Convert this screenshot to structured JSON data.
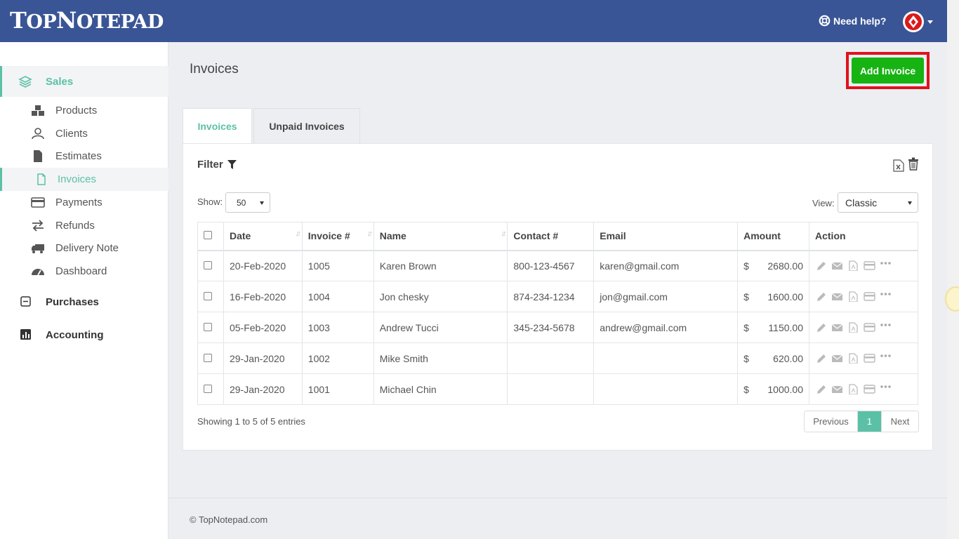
{
  "app": {
    "logo_text": "TopNotepad",
    "help_label": "Need help?"
  },
  "sidebar": {
    "sections": [
      {
        "label": "Sales",
        "icon": "layers-icon"
      },
      {
        "label": "Purchases",
        "icon": "minus-square-icon"
      },
      {
        "label": "Accounting",
        "icon": "bar-chart-icon"
      }
    ],
    "items": [
      {
        "label": "Products",
        "icon": "cubes-icon"
      },
      {
        "label": "Clients",
        "icon": "user-icon"
      },
      {
        "label": "Estimates",
        "icon": "file-icon"
      },
      {
        "label": "Invoices",
        "icon": "file-outline-icon",
        "active": true
      },
      {
        "label": "Payments",
        "icon": "credit-card-icon"
      },
      {
        "label": "Refunds",
        "icon": "exchange-icon"
      },
      {
        "label": "Delivery Note",
        "icon": "truck-icon"
      },
      {
        "label": "Dashboard",
        "icon": "dashboard-icon"
      }
    ]
  },
  "main": {
    "title": "Invoices",
    "add_button": "Add Invoice",
    "tabs": [
      {
        "label": "Invoices",
        "active": true
      },
      {
        "label": "Unpaid Invoices",
        "active": false
      }
    ],
    "filter_label": "Filter",
    "show_label": "Show:",
    "show_value": "50",
    "view_label": "View:",
    "view_value": "Classic",
    "columns": [
      "Date",
      "Invoice #",
      "Name",
      "Contact #",
      "Email",
      "Amount",
      "Action"
    ],
    "currency": "$",
    "rows": [
      {
        "date": "20-Feb-2020",
        "invoice": "1005",
        "name": "Karen Brown",
        "contact": "800-123-4567",
        "email": "karen@gmail.com",
        "amount": "2680.00"
      },
      {
        "date": "16-Feb-2020",
        "invoice": "1004",
        "name": "Jon chesky",
        "contact": "874-234-1234",
        "email": "jon@gmail.com",
        "amount": "1600.00"
      },
      {
        "date": "05-Feb-2020",
        "invoice": "1003",
        "name": "Andrew Tucci",
        "contact": "345-234-5678",
        "email": "andrew@gmail.com",
        "amount": "1150.00"
      },
      {
        "date": "29-Jan-2020",
        "invoice": "1002",
        "name": "Mike Smith",
        "contact": "",
        "email": "",
        "amount": "620.00"
      },
      {
        "date": "29-Jan-2020",
        "invoice": "1001",
        "name": "Michael Chin",
        "contact": "",
        "email": "",
        "amount": "1000.00"
      }
    ],
    "entries_text": "Showing 1 to 5 of 5 entries",
    "pager": {
      "previous": "Previous",
      "current": "1",
      "next": "Next"
    }
  },
  "footer": {
    "text": "© TopNotepad.com"
  },
  "colors": {
    "header": "#3a5596",
    "accent": "#5bc1a6",
    "add_button": "#17b313",
    "highlight_box": "#e0121c"
  }
}
